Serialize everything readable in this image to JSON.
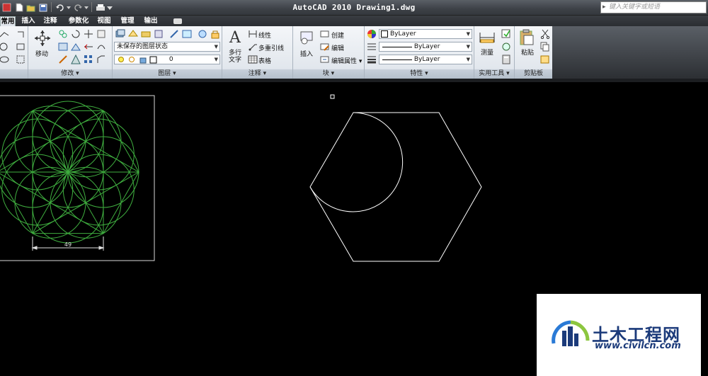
{
  "window": {
    "title": "AutoCAD 2010   Drawing1.dwg"
  },
  "search": {
    "placeholder": "键入关键字或短语"
  },
  "tabs": [
    {
      "label": "常用",
      "active": true
    },
    {
      "label": "插入"
    },
    {
      "label": "注释"
    },
    {
      "label": "参数化"
    },
    {
      "label": "视图"
    },
    {
      "label": "管理"
    },
    {
      "label": "输出"
    }
  ],
  "ribbon": {
    "modify": {
      "title": "修改",
      "move_label": "移动"
    },
    "layers": {
      "title": "图层",
      "layer_state": "未保存的图层状态",
      "current_layer": "0"
    },
    "annotation": {
      "title": "注释",
      "text_label_1": "多行",
      "text_label_2": "文字",
      "linear": "线性",
      "multileader": "多重引线",
      "table": "表格"
    },
    "block": {
      "title": "块",
      "insert": "插入",
      "create": "创建",
      "edit": "编辑",
      "edit_attributes": "编辑属性"
    },
    "properties": {
      "title": "特性",
      "color": "ByLayer",
      "linetype": "ByLayer",
      "lineweight": "ByLayer"
    },
    "utilities": {
      "title": "实用工具",
      "measure": "测量"
    },
    "clipboard": {
      "title": "剪贴板",
      "paste": "粘贴"
    }
  },
  "drawing": {
    "dimension_text": "49"
  },
  "watermark": {
    "name": "土木工程网",
    "url": "www.civilcn.com"
  },
  "colors": {
    "drawing_green": "#3fae3f",
    "drawing_white": "#ffffff",
    "canvas": "#000000",
    "brand_blue": "#1b3a7a"
  }
}
